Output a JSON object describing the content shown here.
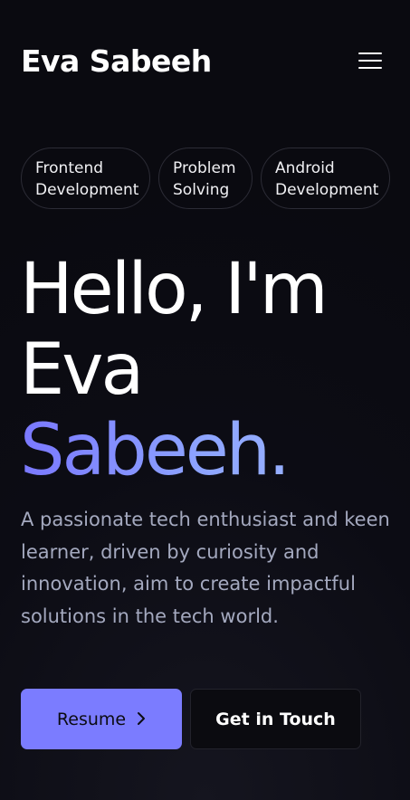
{
  "header": {
    "brand": "Eva Sabeeh",
    "menu_icon": "hamburger-menu-icon"
  },
  "skills": [
    {
      "line1": "Frontend",
      "line2": "Development"
    },
    {
      "line1": "Problem",
      "line2": "Solving"
    },
    {
      "line1": "Android",
      "line2": "Development"
    }
  ],
  "hero": {
    "line1": "Hello, I'm",
    "line2": "Eva",
    "line3": "Sabeeh."
  },
  "description": "A passionate tech enthusiast and keen learner, driven by curiosity and innovation, aim to create impactful solutions in the tech world.",
  "buttons": {
    "resume": "Resume",
    "resume_icon": "chevron-right-icon",
    "contact": "Get in Touch"
  },
  "colors": {
    "accent": "#7b7cff",
    "background": "#0c0c14",
    "text_muted": "#a4a9bf"
  }
}
